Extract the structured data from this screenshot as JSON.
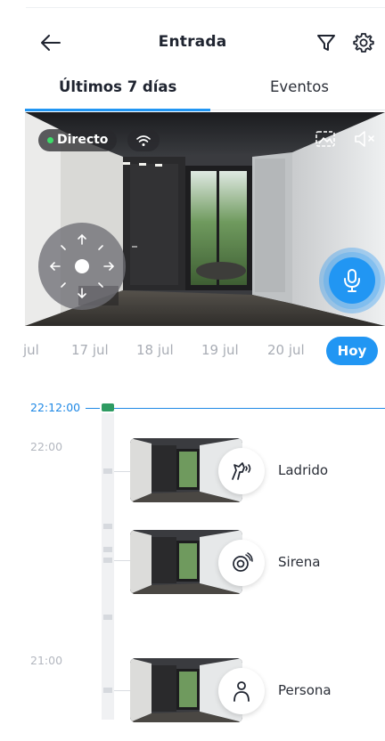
{
  "header": {
    "title": "Entrada"
  },
  "tabs": [
    {
      "label": "Últimos 7 días",
      "active": true
    },
    {
      "label": "Eventos",
      "active": false
    }
  ],
  "camera": {
    "live_label": "Directo",
    "live_status_color": "#3ddc6a"
  },
  "date_strip": {
    "dates": [
      "jul",
      "17 jul",
      "18 jul",
      "19 jul",
      "20 jul"
    ],
    "today_label": "Hoy"
  },
  "timeline": {
    "current_time": "22:12:00",
    "hours": [
      "22:00",
      "21:00"
    ],
    "events": [
      {
        "label": "Ladrido",
        "icon": "dog-bark-icon"
      },
      {
        "label": "Sirena",
        "icon": "siren-icon"
      },
      {
        "label": "Persona",
        "icon": "person-icon"
      }
    ]
  },
  "colors": {
    "accent": "#2196f3",
    "timeline_now": "#1e88e5",
    "now_marker": "#2e9b62"
  }
}
